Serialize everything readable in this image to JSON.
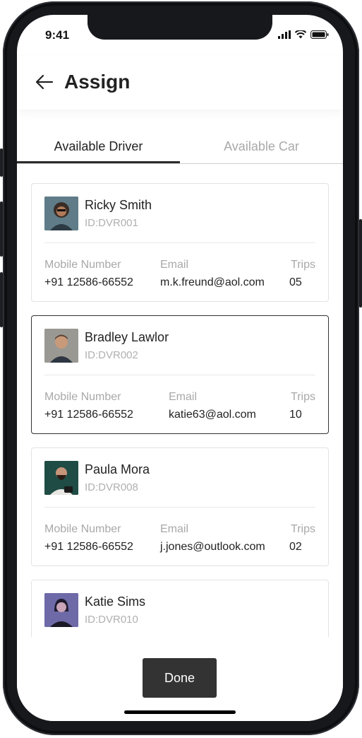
{
  "status_bar": {
    "time": "9:41"
  },
  "header": {
    "title": "Assign"
  },
  "tabs": [
    {
      "label": "Available Driver",
      "active": true
    },
    {
      "label": "Available Car",
      "active": false
    }
  ],
  "labels": {
    "mobile": "Mobile Number",
    "email": "Email",
    "trips": "Trips"
  },
  "drivers": [
    {
      "name": "Ricky Smith",
      "id": "ID:DVR001",
      "mobile": "+91 12586-66552",
      "email": "m.k.freund@aol.com",
      "trips": "05",
      "selected": false,
      "avatar_bg": "#4e6b78"
    },
    {
      "name": "Bradley Lawlor",
      "id": "ID:DVR002",
      "mobile": "+91 12586-66552",
      "email": "katie63@aol.com",
      "trips": "10",
      "selected": true,
      "avatar_bg": "#8b8a86"
    },
    {
      "name": "Paula Mora",
      "id": "ID:DVR008",
      "mobile": "+91 12586-66552",
      "email": "j.jones@outlook.com",
      "trips": "02",
      "selected": false,
      "avatar_bg": "#1f4c44"
    },
    {
      "name": "Katie Sims",
      "id": "ID:DVR010",
      "mobile": "",
      "email": "",
      "trips": "",
      "selected": false,
      "avatar_bg": "#6e6aa8"
    }
  ],
  "footer": {
    "done_label": "Done"
  },
  "colors": {
    "accent": "#333333",
    "muted": "#a8a8a8",
    "border": "#e3e3e3"
  }
}
